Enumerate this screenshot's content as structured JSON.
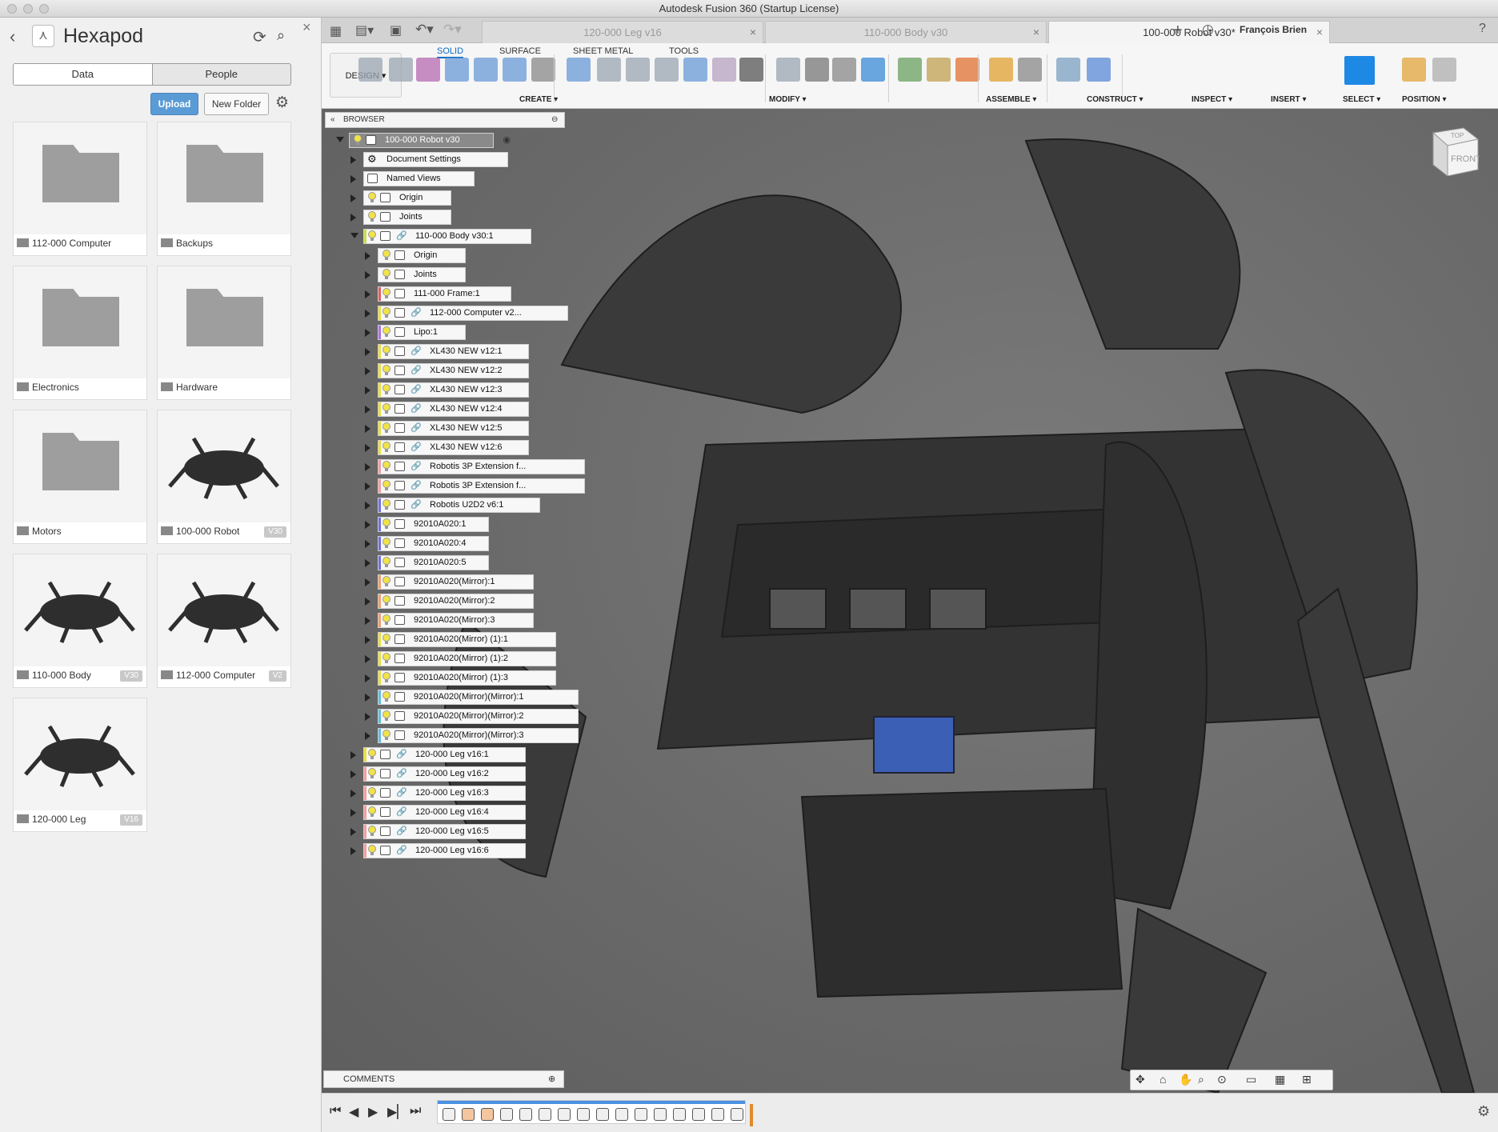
{
  "window": {
    "title": "Autodesk Fusion 360 (Startup License)"
  },
  "data_panel": {
    "title": "Hexapod",
    "tabs": [
      "Data",
      "People"
    ],
    "upload_label": "Upload",
    "new_folder_label": "New Folder",
    "items": [
      {
        "name": "112-000 Computer",
        "kind": "folder",
        "version": ""
      },
      {
        "name": "Backups",
        "kind": "folder",
        "version": ""
      },
      {
        "name": "Electronics",
        "kind": "folder",
        "version": ""
      },
      {
        "name": "Hardware",
        "kind": "folder",
        "version": ""
      },
      {
        "name": "Motors",
        "kind": "folder",
        "version": ""
      },
      {
        "name": "100-000 Robot",
        "kind": "design",
        "version": "V30"
      },
      {
        "name": "110-000 Body",
        "kind": "design",
        "version": "V30"
      },
      {
        "name": "112-000 Computer",
        "kind": "design",
        "version": "V2"
      },
      {
        "name": "120-000 Leg",
        "kind": "design",
        "version": "V16"
      }
    ]
  },
  "doc_tabs": [
    {
      "label": "120-000 Leg v16",
      "active": false
    },
    {
      "label": "110-000 Body v30",
      "active": false
    },
    {
      "label": "100-000 Robot v30*",
      "active": true
    }
  ],
  "user_name": "François Brien",
  "ribbon": {
    "tabs": [
      "SOLID",
      "SURFACE",
      "SHEET METAL",
      "TOOLS"
    ],
    "active_tab": "SOLID",
    "workspace": "DESIGN ▾",
    "groups": [
      "CREATE ▾",
      "MODIFY ▾",
      "ASSEMBLE ▾",
      "CONSTRUCT ▾",
      "INSPECT ▾",
      "INSERT ▾",
      "SELECT ▾",
      "POSITION ▾"
    ]
  },
  "browser": {
    "title": "BROWSER",
    "rows": [
      {
        "label": "100-000 Robot v30",
        "level": 0,
        "expanded": true,
        "root": true,
        "type": "component"
      },
      {
        "label": "Document Settings",
        "level": 1,
        "type": "settings"
      },
      {
        "label": "Named Views",
        "level": 1,
        "type": "folder"
      },
      {
        "label": "Origin",
        "level": 1,
        "type": "folder",
        "bulb": true
      },
      {
        "label": "Joints",
        "level": 1,
        "type": "folder",
        "bulb": true
      },
      {
        "label": "110-000 Body v30:1",
        "level": 1,
        "expanded": true,
        "type": "link",
        "bulb": true,
        "color": "#c8e04a"
      },
      {
        "label": "Origin",
        "level": 2,
        "type": "folder",
        "bulb": true
      },
      {
        "label": "Joints",
        "level": 2,
        "type": "folder",
        "bulb": true
      },
      {
        "label": "111-000 Frame:1",
        "level": 2,
        "type": "component",
        "bulb": true,
        "color": "#e06060"
      },
      {
        "label": "112-000 Computer v2...",
        "level": 2,
        "type": "link",
        "bulb": true,
        "color": "#e8e040"
      },
      {
        "label": "Lipo:1",
        "level": 2,
        "type": "component",
        "bulb": true,
        "color": "#b070e0"
      },
      {
        "label": "XL430 NEW v12:1",
        "level": 2,
        "type": "link",
        "bulb": true,
        "color": "#e8e040"
      },
      {
        "label": "XL430 NEW v12:2",
        "level": 2,
        "type": "link",
        "bulb": true,
        "color": "#e8e040"
      },
      {
        "label": "XL430 NEW v12:3",
        "level": 2,
        "type": "link",
        "bulb": true,
        "color": "#e8e040"
      },
      {
        "label": "XL430 NEW v12:4",
        "level": 2,
        "type": "link",
        "bulb": true,
        "color": "#e8e040"
      },
      {
        "label": "XL430 NEW v12:5",
        "level": 2,
        "type": "link",
        "bulb": true,
        "color": "#e8e040"
      },
      {
        "label": "XL430 NEW v12:6",
        "level": 2,
        "type": "link",
        "bulb": true,
        "color": "#e8e040"
      },
      {
        "label": "Robotis 3P Extension f...",
        "level": 2,
        "type": "link",
        "bulb": true,
        "color": "#f0a0a0"
      },
      {
        "label": "Robotis 3P Extension f...",
        "level": 2,
        "type": "link",
        "bulb": true,
        "color": "#f0a0a0"
      },
      {
        "label": "Robotis U2D2 v6:1",
        "level": 2,
        "type": "link",
        "bulb": true,
        "color": "#7070e0"
      },
      {
        "label": "92010A020:1",
        "level": 2,
        "type": "component",
        "bulb": true,
        "color": "#7070e0"
      },
      {
        "label": "92010A020:4",
        "level": 2,
        "type": "component",
        "bulb": true,
        "color": "#7070e0"
      },
      {
        "label": "92010A020:5",
        "level": 2,
        "type": "component",
        "bulb": true,
        "color": "#7070e0"
      },
      {
        "label": "92010A020(Mirror):1",
        "level": 2,
        "type": "component",
        "bulb": true,
        "color": "#f0a070"
      },
      {
        "label": "92010A020(Mirror):2",
        "level": 2,
        "type": "component",
        "bulb": true,
        "color": "#f0a070"
      },
      {
        "label": "92010A020(Mirror):3",
        "level": 2,
        "type": "component",
        "bulb": true,
        "color": "#f0a070"
      },
      {
        "label": "92010A020(Mirror) (1):1",
        "level": 2,
        "type": "component",
        "bulb": true,
        "color": "#e8e040"
      },
      {
        "label": "92010A020(Mirror) (1):2",
        "level": 2,
        "type": "component",
        "bulb": true,
        "color": "#e8e040"
      },
      {
        "label": "92010A020(Mirror) (1):3",
        "level": 2,
        "type": "component",
        "bulb": true,
        "color": "#e8e040"
      },
      {
        "label": "92010A020(Mirror)(Mirror):1",
        "level": 2,
        "type": "component",
        "bulb": true,
        "color": "#60c0e0"
      },
      {
        "label": "92010A020(Mirror)(Mirror):2",
        "level": 2,
        "type": "component",
        "bulb": true,
        "color": "#60c0e0"
      },
      {
        "label": "92010A020(Mirror)(Mirror):3",
        "level": 2,
        "type": "component",
        "bulb": true,
        "color": "#60c0e0"
      },
      {
        "label": "120-000 Leg v16:1",
        "level": 1,
        "type": "link",
        "bulb": true,
        "color": "#e8e040"
      },
      {
        "label": "120-000 Leg v16:2",
        "level": 1,
        "type": "link",
        "bulb": true,
        "color": "#f0a0a0"
      },
      {
        "label": "120-000 Leg v16:3",
        "level": 1,
        "type": "link",
        "bulb": true,
        "color": "#f0a0a0"
      },
      {
        "label": "120-000 Leg v16:4",
        "level": 1,
        "type": "link",
        "bulb": true,
        "color": "#f0a0a0"
      },
      {
        "label": "120-000 Leg v16:5",
        "level": 1,
        "type": "link",
        "bulb": true,
        "color": "#f0a0a0"
      },
      {
        "label": "120-000 Leg v16:6",
        "level": 1,
        "type": "link",
        "bulb": true,
        "color": "#f0a0a0"
      }
    ]
  },
  "viewcube": {
    "top_face": "TOP",
    "front_face": "FRONT"
  },
  "comments_label": "COMMENTS",
  "timeline": {
    "feature_count": 16
  }
}
